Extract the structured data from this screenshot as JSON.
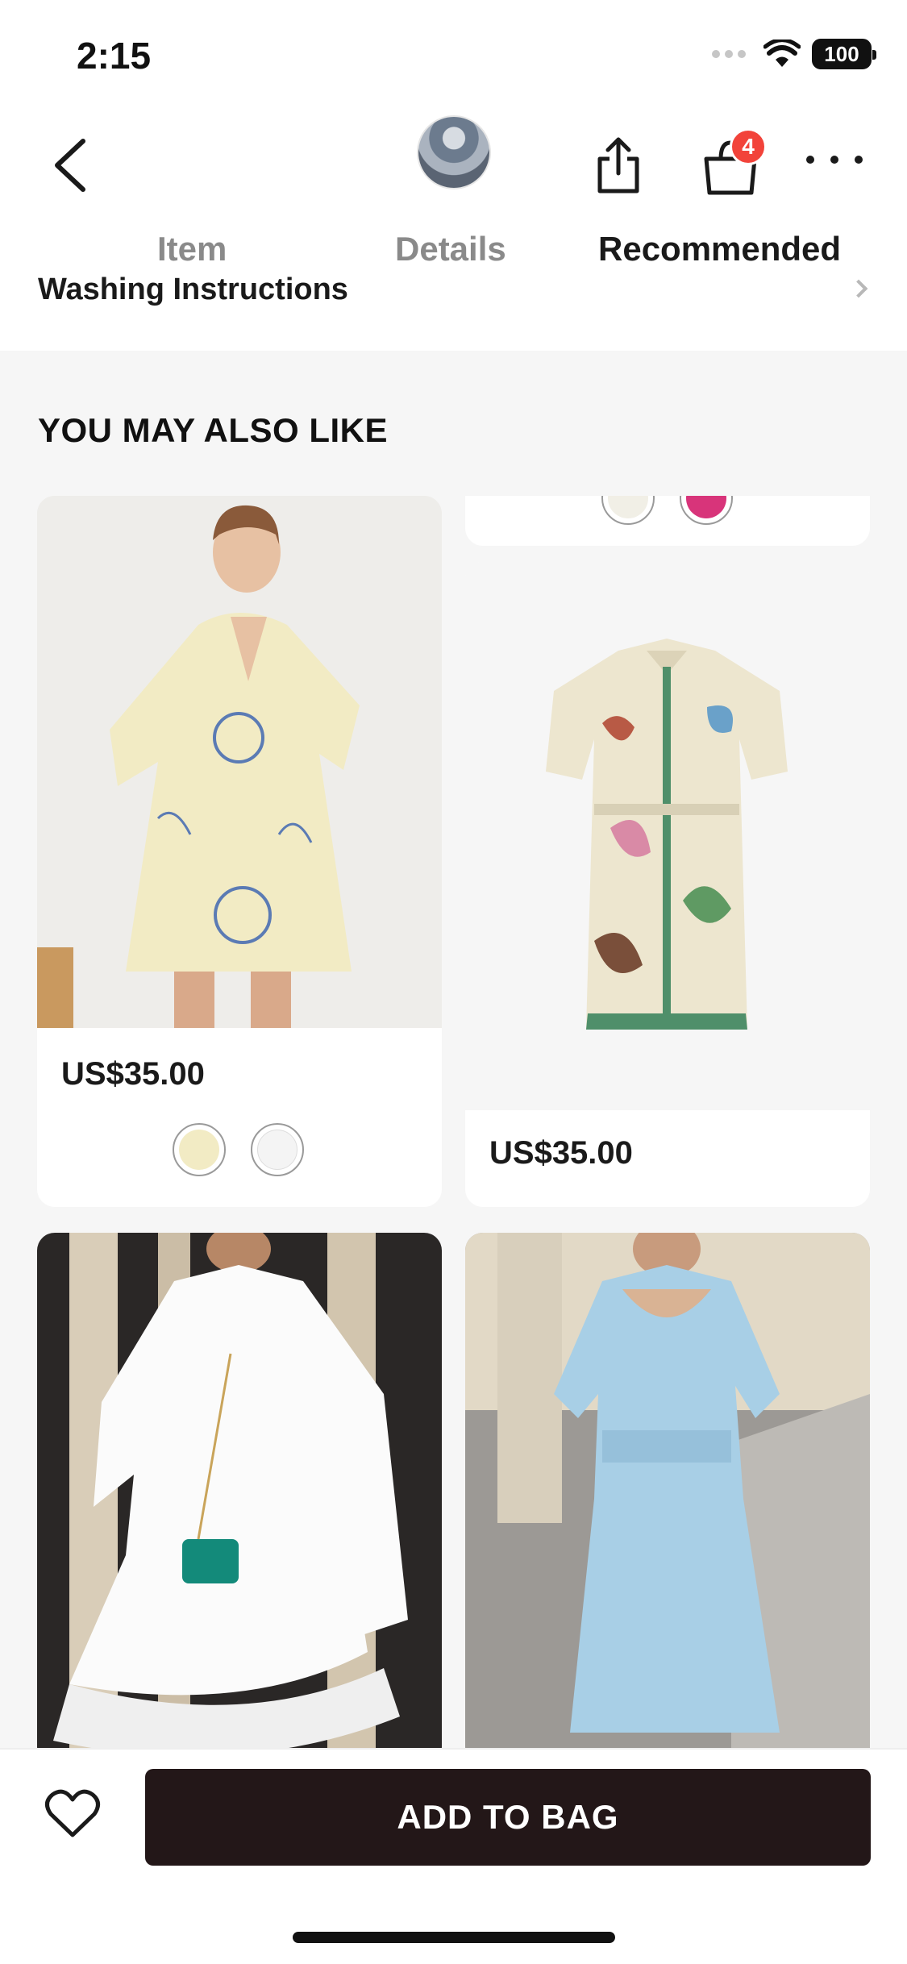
{
  "status_bar": {
    "time": "2:15",
    "battery": "100"
  },
  "header": {
    "cart_count": "4"
  },
  "tabs": [
    {
      "label": "Item"
    },
    {
      "label": "Details"
    },
    {
      "label": "Recommended"
    }
  ],
  "partial_row": {
    "label": "Washing Instructions"
  },
  "section": {
    "title": "YOU MAY ALSO LIKE"
  },
  "products": [
    {
      "price": "US$35.00",
      "swatch_colors": [
        "#f2ebc4",
        "#f4f4f4"
      ]
    },
    {
      "price": "US$35.00"
    },
    {
      "price": ""
    },
    {
      "price": ""
    }
  ],
  "partial_card_swatches": [
    "#f1efe6",
    "#d8347a"
  ],
  "bottom_bar": {
    "add_label": "ADD TO BAG"
  },
  "colors": {
    "accent_dark": "#231718",
    "badge": "#f2433a"
  }
}
